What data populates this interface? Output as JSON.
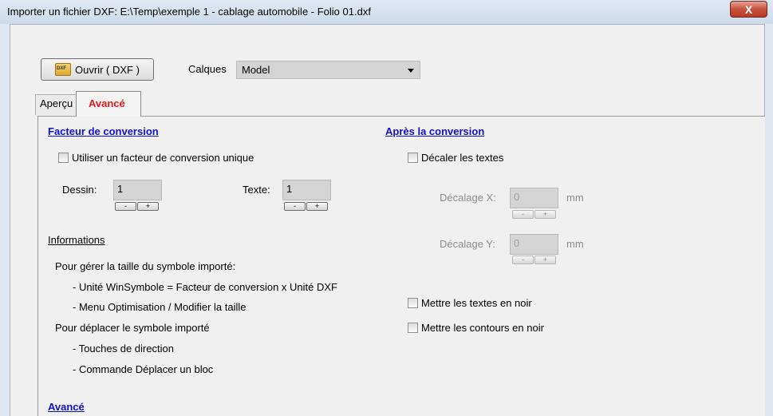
{
  "window": {
    "title": "Importer un fichier DXF: E:\\Temp\\exemple 1 - cablage automobile - Folio 01.dxf",
    "close_label": "X"
  },
  "toolbar": {
    "open_label": "Ouvrir ( DXF )",
    "open_icon": "dxf-file-icon",
    "layers_label": "Calques",
    "layers_value": "Model"
  },
  "tabs": [
    {
      "label": "Aperçu",
      "active": false
    },
    {
      "label": "Avancé",
      "active": true
    }
  ],
  "conversion": {
    "heading": "Facteur de conversion",
    "unique_factor_label": "Utiliser un facteur de conversion unique",
    "unique_factor_checked": false,
    "drawing_label": "Dessin:",
    "drawing_value": "1",
    "text_label": "Texte:",
    "text_value": "1",
    "minus": "-",
    "plus": "+"
  },
  "informations": {
    "heading": "Informations",
    "lines": [
      "Pour gérer la taille du symbole importé:",
      "- Unité WinSymbole = Facteur de conversion x Unité DXF",
      "- Menu Optimisation / Modifier la  taille",
      "Pour déplacer le symbole importé",
      "- Touches de direction",
      "- Commande Déplacer un bloc"
    ]
  },
  "after": {
    "heading": "Après la conversion",
    "shift_texts_label": "Décaler les textes",
    "shift_texts_checked": false,
    "offset_x_label": "Décalage X:",
    "offset_x_value": "0",
    "offset_y_label": "Décalage Y:",
    "offset_y_value": "0",
    "unit": "mm",
    "minus": "-",
    "plus": "+",
    "black_texts_label": "Mettre les textes en noir",
    "black_texts_checked": false,
    "black_outlines_label": "Mettre les contours en noir",
    "black_outlines_checked": false
  },
  "advanced": {
    "heading": "Avancé"
  }
}
